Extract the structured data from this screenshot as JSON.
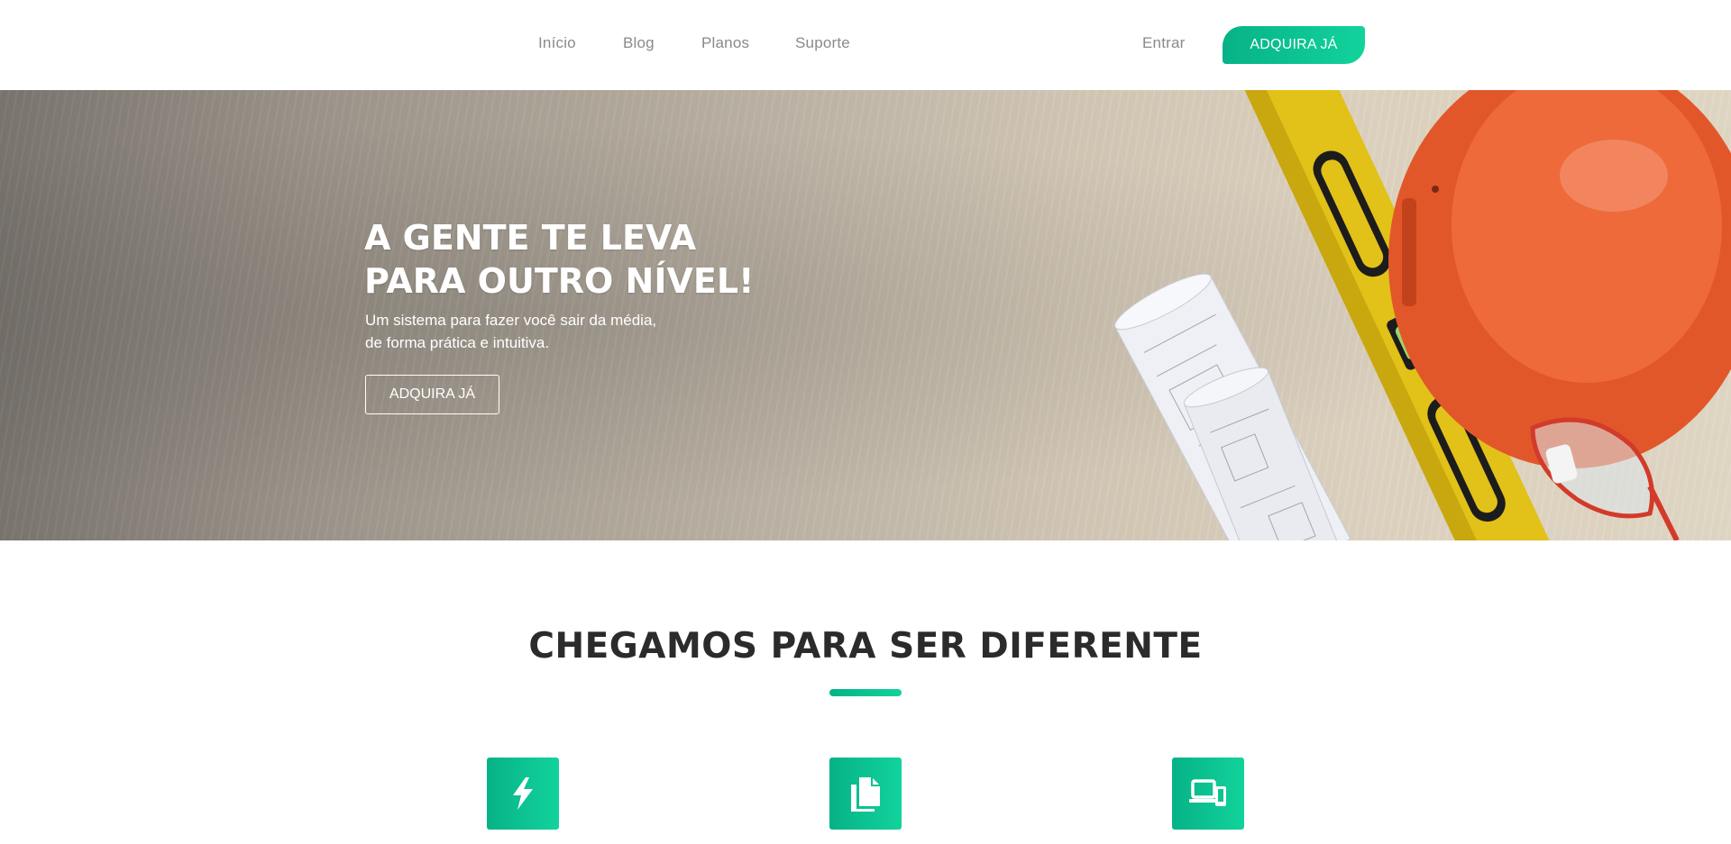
{
  "nav": {
    "items": [
      {
        "label": "Início"
      },
      {
        "label": "Blog"
      },
      {
        "label": "Planos"
      },
      {
        "label": "Suporte"
      }
    ],
    "login_label": "Entrar",
    "cta_label": "ADQUIRA JÁ"
  },
  "hero": {
    "title_line1": "A GENTE TE LEVA",
    "title_line2": "PARA OUTRO NÍVEL!",
    "subtitle_line1": "Um sistema para fazer você sair da média,",
    "subtitle_line2": "de forma prática e intuitiva.",
    "button_label": "ADQUIRA JÁ"
  },
  "features": {
    "title": "CHEGAMOS PARA SER DIFERENTE",
    "icons": [
      "lightning-icon",
      "documents-icon",
      "devices-icon"
    ]
  },
  "colors": {
    "accent_start": "#06b287",
    "accent_end": "#12d39c",
    "heading": "#2b2b2b",
    "nav_text": "#8a8a8a"
  }
}
